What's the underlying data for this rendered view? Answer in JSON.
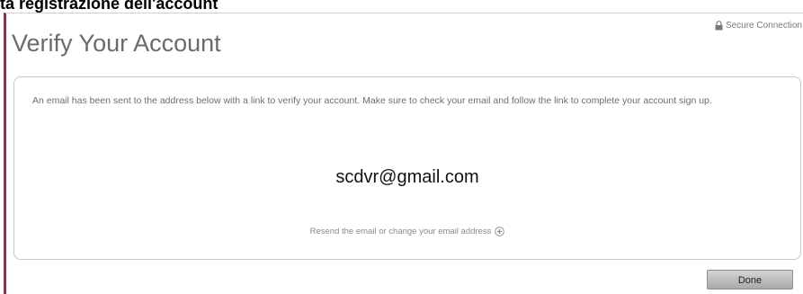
{
  "caption": "ta registrazione dell'account",
  "window": {
    "secure_label": "Secure Connection",
    "lock_icon": "lock-icon",
    "title": "Verify Your Account"
  },
  "panel": {
    "message": "An email has been sent to the address below with a link to verify your account. Make sure to check your email and follow the link to complete your account sign up.",
    "email": "scdvr@gmail.com",
    "resend_text": "Resend the email or change your email address",
    "expand_icon": "plus-circle-icon"
  },
  "footer": {
    "done_label": "Done"
  }
}
